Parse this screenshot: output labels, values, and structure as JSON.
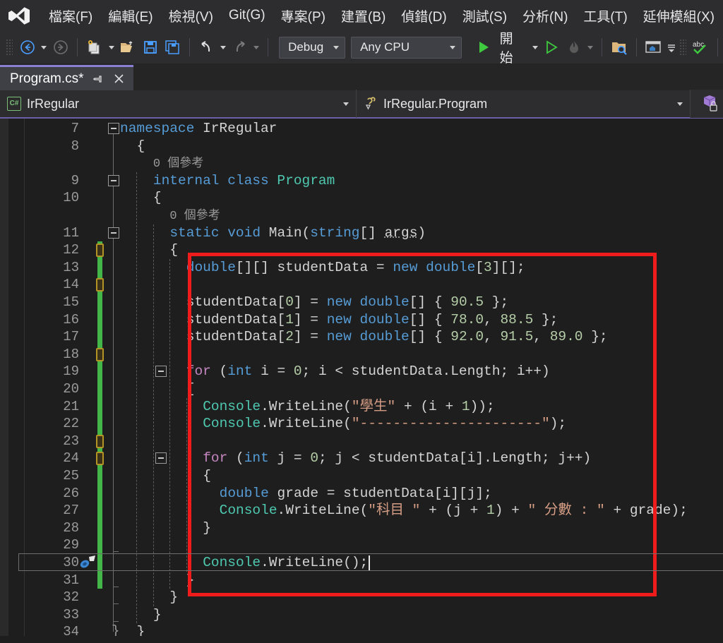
{
  "app": {
    "logo_icon": "visual-studio-logo-icon"
  },
  "menubar": {
    "items": [
      {
        "label": "檔案(F)",
        "name": "menu-file"
      },
      {
        "label": "編輯(E)",
        "name": "menu-edit"
      },
      {
        "label": "檢視(V)",
        "name": "menu-view"
      },
      {
        "label": "Git(G)",
        "name": "menu-git"
      },
      {
        "label": "專案(P)",
        "name": "menu-project"
      },
      {
        "label": "建置(B)",
        "name": "menu-build"
      },
      {
        "label": "偵錯(D)",
        "name": "menu-debug"
      },
      {
        "label": "測試(S)",
        "name": "menu-test"
      },
      {
        "label": "分析(N)",
        "name": "menu-analyze"
      },
      {
        "label": "工具(T)",
        "name": "menu-tools"
      },
      {
        "label": "延伸模組(X)",
        "name": "menu-extensions"
      }
    ]
  },
  "toolbar": {
    "configuration": "Debug",
    "platform": "Any CPU",
    "start_label": "開始",
    "icons": [
      "navigate-back-icon",
      "navigate-forward-icon",
      "new-project-icon",
      "open-file-icon",
      "save-icon",
      "save-all-icon",
      "undo-icon",
      "redo-icon",
      "start-debug-icon",
      "start-without-debug-icon",
      "hot-reload-icon",
      "find-in-files-icon",
      "solution-explorer-icon",
      "spell-check-icon"
    ]
  },
  "tab": {
    "title": "Program.cs*",
    "pin_icon": "pin-icon",
    "close_icon": "close-icon"
  },
  "navbar": {
    "project": "IrRegular",
    "member": "IrRegular.Program",
    "project_icon": "csharp-file-icon",
    "member_icon": "method-icon",
    "lock_icon": "locked-package-icon"
  },
  "editor": {
    "first_line_number": 7,
    "line_numbers": [
      7,
      8,
      9,
      10,
      11,
      12,
      13,
      14,
      15,
      16,
      17,
      18,
      19,
      20,
      21,
      22,
      23,
      24,
      25,
      26,
      27,
      28,
      29,
      30,
      31,
      32,
      33,
      34
    ],
    "current_line": 30,
    "codelens_text": "0 個參考",
    "quick_actions_icon": "quick-actions-screwdriver-icon",
    "lines": [
      {
        "n": 7,
        "indent": 0,
        "tokens": [
          {
            "t": "namespace",
            "c": "k"
          },
          {
            "t": " IrRegular",
            "c": "id"
          }
        ]
      },
      {
        "n": 8,
        "indent": 1,
        "tokens": [
          {
            "t": "{",
            "c": "id"
          }
        ]
      },
      {
        "n": 0,
        "indent": 2,
        "codelens": "0 個參考"
      },
      {
        "n": 9,
        "indent": 2,
        "tokens": [
          {
            "t": "internal",
            "c": "k"
          },
          {
            "t": " ",
            "c": "id"
          },
          {
            "t": "class",
            "c": "k"
          },
          {
            "t": " ",
            "c": "id"
          },
          {
            "t": "Program",
            "c": "t"
          }
        ]
      },
      {
        "n": 10,
        "indent": 2,
        "tokens": [
          {
            "t": "{",
            "c": "id"
          }
        ]
      },
      {
        "n": 0,
        "indent": 3,
        "codelens": "0 個參考"
      },
      {
        "n": 11,
        "indent": 3,
        "tokens": [
          {
            "t": "static",
            "c": "k"
          },
          {
            "t": " ",
            "c": "id"
          },
          {
            "t": "void",
            "c": "k"
          },
          {
            "t": " Main(",
            "c": "id"
          },
          {
            "t": "string",
            "c": "k"
          },
          {
            "t": "[] ",
            "c": "id"
          },
          {
            "t": "args",
            "c": "under"
          },
          {
            "t": ")",
            "c": "id"
          }
        ]
      },
      {
        "n": 12,
        "indent": 3,
        "tokens": [
          {
            "t": "{",
            "c": "id"
          }
        ]
      },
      {
        "n": 13,
        "indent": 4,
        "tokens": [
          {
            "t": "double",
            "c": "k"
          },
          {
            "t": "[][] studentData = ",
            "c": "id"
          },
          {
            "t": "new",
            "c": "k"
          },
          {
            "t": " ",
            "c": "id"
          },
          {
            "t": "double",
            "c": "k"
          },
          {
            "t": "[",
            "c": "id"
          },
          {
            "t": "3",
            "c": "n"
          },
          {
            "t": "][];",
            "c": "id"
          }
        ]
      },
      {
        "n": 14,
        "indent": 4,
        "tokens": []
      },
      {
        "n": 15,
        "indent": 4,
        "tokens": [
          {
            "t": "studentData[",
            "c": "id"
          },
          {
            "t": "0",
            "c": "n"
          },
          {
            "t": "] = ",
            "c": "id"
          },
          {
            "t": "new",
            "c": "k"
          },
          {
            "t": " ",
            "c": "id"
          },
          {
            "t": "double",
            "c": "k"
          },
          {
            "t": "[] { ",
            "c": "id"
          },
          {
            "t": "90.5",
            "c": "n"
          },
          {
            "t": " };",
            "c": "id"
          }
        ]
      },
      {
        "n": 16,
        "indent": 4,
        "tokens": [
          {
            "t": "studentData[",
            "c": "id"
          },
          {
            "t": "1",
            "c": "n"
          },
          {
            "t": "] = ",
            "c": "id"
          },
          {
            "t": "new",
            "c": "k"
          },
          {
            "t": " ",
            "c": "id"
          },
          {
            "t": "double",
            "c": "k"
          },
          {
            "t": "[] { ",
            "c": "id"
          },
          {
            "t": "78.0",
            "c": "n"
          },
          {
            "t": ", ",
            "c": "id"
          },
          {
            "t": "88.5",
            "c": "n"
          },
          {
            "t": " };",
            "c": "id"
          }
        ]
      },
      {
        "n": 17,
        "indent": 4,
        "tokens": [
          {
            "t": "studentData[",
            "c": "id"
          },
          {
            "t": "2",
            "c": "n"
          },
          {
            "t": "] = ",
            "c": "id"
          },
          {
            "t": "new",
            "c": "k"
          },
          {
            "t": " ",
            "c": "id"
          },
          {
            "t": "double",
            "c": "k"
          },
          {
            "t": "[] { ",
            "c": "id"
          },
          {
            "t": "92.0",
            "c": "n"
          },
          {
            "t": ", ",
            "c": "id"
          },
          {
            "t": "91.5",
            "c": "n"
          },
          {
            "t": ", ",
            "c": "id"
          },
          {
            "t": "89.0",
            "c": "n"
          },
          {
            "t": " };",
            "c": "id"
          }
        ]
      },
      {
        "n": 18,
        "indent": 4,
        "tokens": []
      },
      {
        "n": 19,
        "indent": 4,
        "tokens": [
          {
            "t": "for",
            "c": "kc"
          },
          {
            "t": " (",
            "c": "id"
          },
          {
            "t": "int",
            "c": "k"
          },
          {
            "t": " i = ",
            "c": "id"
          },
          {
            "t": "0",
            "c": "n"
          },
          {
            "t": "; i < studentData.Length; i++)",
            "c": "id"
          }
        ]
      },
      {
        "n": 20,
        "indent": 4,
        "tokens": [
          {
            "t": "{",
            "c": "id"
          }
        ]
      },
      {
        "n": 21,
        "indent": 5,
        "tokens": [
          {
            "t": "Console",
            "c": "t"
          },
          {
            "t": ".WriteLine(",
            "c": "id"
          },
          {
            "t": "\"學生\"",
            "c": "s"
          },
          {
            "t": " + (i + ",
            "c": "id"
          },
          {
            "t": "1",
            "c": "n"
          },
          {
            "t": "));",
            "c": "id"
          }
        ]
      },
      {
        "n": 22,
        "indent": 5,
        "tokens": [
          {
            "t": "Console",
            "c": "t"
          },
          {
            "t": ".WriteLine(",
            "c": "id"
          },
          {
            "t": "\"----------------------\"",
            "c": "s"
          },
          {
            "t": ");",
            "c": "id"
          }
        ]
      },
      {
        "n": 23,
        "indent": 5,
        "tokens": []
      },
      {
        "n": 24,
        "indent": 5,
        "tokens": [
          {
            "t": "for",
            "c": "kc"
          },
          {
            "t": " (",
            "c": "id"
          },
          {
            "t": "int",
            "c": "k"
          },
          {
            "t": " j = ",
            "c": "id"
          },
          {
            "t": "0",
            "c": "n"
          },
          {
            "t": "; j < studentData[i].Length; j++)",
            "c": "id"
          }
        ]
      },
      {
        "n": 25,
        "indent": 5,
        "tokens": [
          {
            "t": "{",
            "c": "id"
          }
        ]
      },
      {
        "n": 26,
        "indent": 6,
        "tokens": [
          {
            "t": "double",
            "c": "k"
          },
          {
            "t": " grade = studentData[i][j];",
            "c": "id"
          }
        ]
      },
      {
        "n": 27,
        "indent": 6,
        "tokens": [
          {
            "t": "Console",
            "c": "t"
          },
          {
            "t": ".WriteLine(",
            "c": "id"
          },
          {
            "t": "\"科目 \"",
            "c": "s"
          },
          {
            "t": " + (j + ",
            "c": "id"
          },
          {
            "t": "1",
            "c": "n"
          },
          {
            "t": ") + ",
            "c": "id"
          },
          {
            "t": "\" 分數 : \"",
            "c": "s"
          },
          {
            "t": " + grade);",
            "c": "id"
          }
        ]
      },
      {
        "n": 28,
        "indent": 5,
        "tokens": [
          {
            "t": "}",
            "c": "id"
          }
        ]
      },
      {
        "n": 29,
        "indent": 5,
        "tokens": []
      },
      {
        "n": 30,
        "indent": 5,
        "tokens": [
          {
            "t": "Console",
            "c": "t"
          },
          {
            "t": ".WriteLine();",
            "c": "id"
          }
        ]
      },
      {
        "n": 31,
        "indent": 4,
        "tokens": [
          {
            "t": "}",
            "c": "id"
          }
        ]
      },
      {
        "n": 32,
        "indent": 3,
        "tokens": [
          {
            "t": "}",
            "c": "id"
          }
        ]
      },
      {
        "n": 33,
        "indent": 2,
        "tokens": [
          {
            "t": "}",
            "c": "id"
          }
        ]
      },
      {
        "n": 34,
        "indent": 1,
        "tokens": [
          {
            "t": "}",
            "c": "id"
          }
        ]
      }
    ]
  },
  "annotation": {
    "highlight_color": "#f01b1b",
    "shape": "rectangle"
  },
  "colors": {
    "background": "#1e1e1e",
    "chrome": "#2d2d30",
    "tab_accent": "#8b7fd4",
    "change_bar": "#43b549",
    "keyword": "#569cd6",
    "control_keyword": "#c586c0",
    "type": "#4ec9b0",
    "string": "#d69d85",
    "number": "#b5cea8"
  }
}
